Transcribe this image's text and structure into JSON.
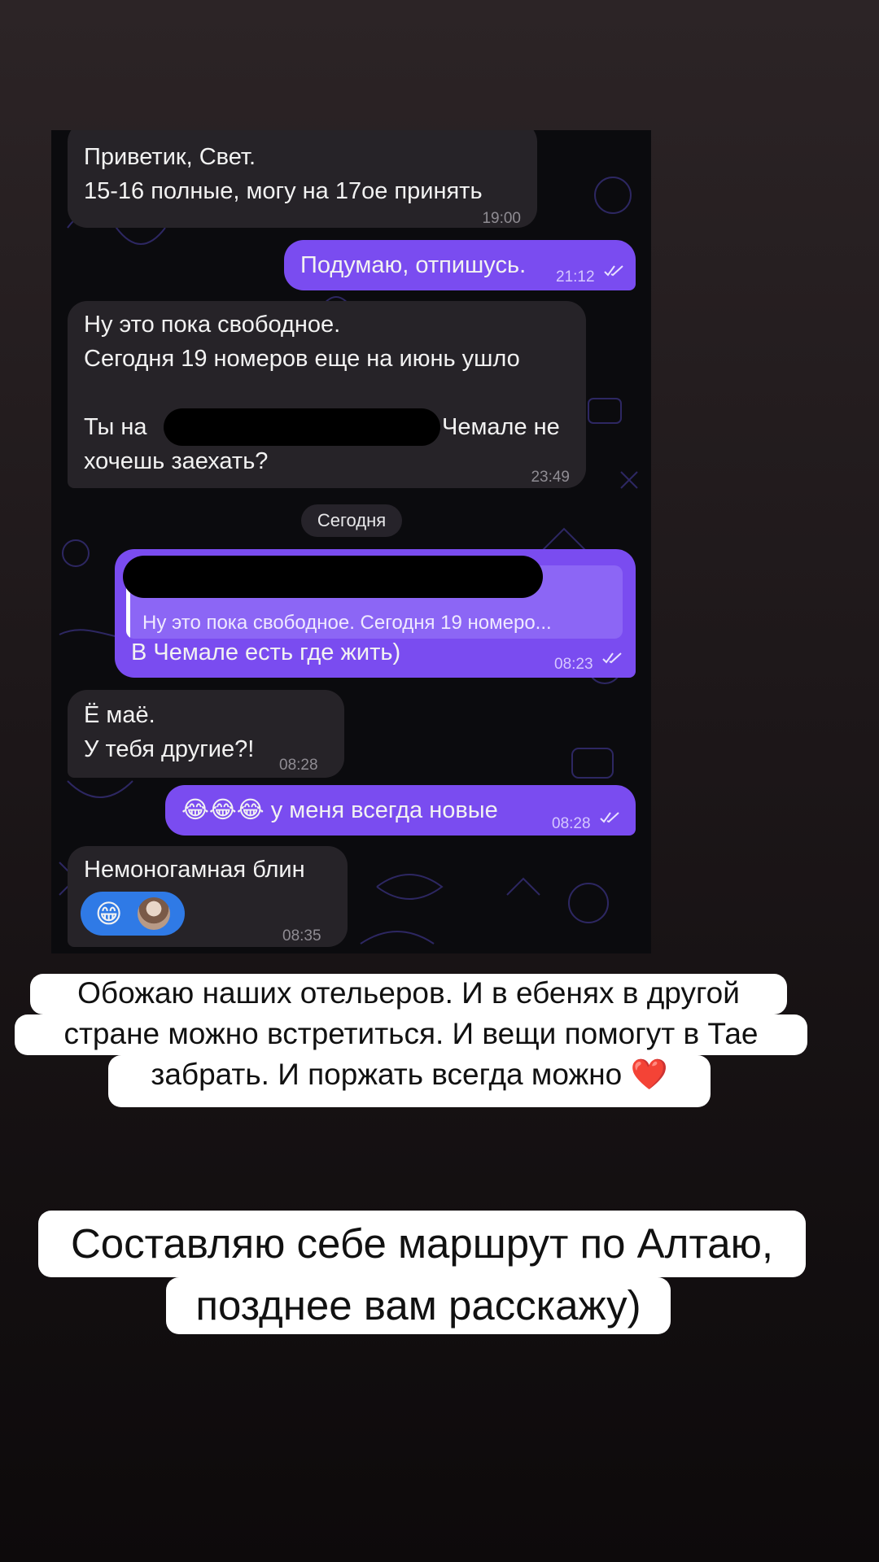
{
  "chat": {
    "date_separator": "Сегодня",
    "messages": [
      {
        "id": "m1",
        "dir": "in",
        "lines": [
          "Приветик, Свет.",
          "15-16 полные, могу на 17ое принять"
        ],
        "time": "19:00"
      },
      {
        "id": "m2",
        "dir": "out",
        "lines": [
          "Подумаю, отпишусь."
        ],
        "time": "21:12",
        "read": true
      },
      {
        "id": "m3",
        "dir": "in",
        "lines": [
          "Ну это пока свободное.",
          "Сегодня 19 номеров еще на июнь ушло",
          "",
          "Ты на",
          "Чемале не",
          "хочешь заехать?"
        ],
        "time": "23:49"
      },
      {
        "id": "m4",
        "dir": "out",
        "reply_quote": "Ну это пока свободное. Сегодня 19 номеро...",
        "lines": [
          "В Чемале есть где жить)"
        ],
        "time": "08:23",
        "read": true
      },
      {
        "id": "m5",
        "dir": "in",
        "lines": [
          "Ё маё.",
          "У тебя другие?!"
        ],
        "time": "08:28"
      },
      {
        "id": "m6",
        "dir": "out",
        "lines": [
          "😂😂😂 у меня всегда новые"
        ],
        "time": "08:28",
        "read": true
      },
      {
        "id": "m7",
        "dir": "in",
        "lines": [
          "Немоногамная блин"
        ],
        "time": "08:35",
        "reaction": "😁"
      }
    ]
  },
  "captions": {
    "c1": [
      "Обожаю наших отельеров. И в ебенях в другой",
      "стране можно встретиться. И вещи помогут в Тае",
      "забрать. И поржать всегда можно ❤️"
    ],
    "c2": [
      "Составляю себе маршрут по Алтаю,",
      "позднее вам расскажу)"
    ]
  },
  "colors": {
    "incoming": "#262328",
    "outgoing": "#7a4cf0",
    "reaction": "#2f7ae6"
  },
  "icons": {
    "read": "double-check-icon",
    "doodle": "chat-background-doodles",
    "reaction_avatar": "user-avatar"
  }
}
